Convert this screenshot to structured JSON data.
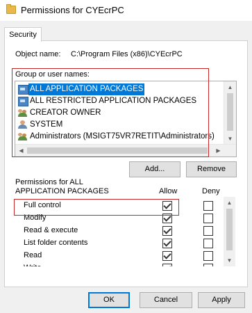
{
  "window": {
    "title": "Permissions for CYEcrPC"
  },
  "tabs": [
    {
      "label": "Security"
    }
  ],
  "object": {
    "label": "Object name:",
    "value": "C:\\Program Files (x86)\\CYEcrPC"
  },
  "groups": {
    "label": "Group or user names:",
    "items": [
      {
        "name": "ALL APPLICATION PACKAGES",
        "icon": "app-package-icon",
        "selected": true
      },
      {
        "name": "ALL RESTRICTED APPLICATION PACKAGES",
        "icon": "app-package-icon",
        "selected": false
      },
      {
        "name": "CREATOR OWNER",
        "icon": "user-group-icon",
        "selected": false
      },
      {
        "name": "SYSTEM",
        "icon": "user-icon",
        "selected": false
      },
      {
        "name": "Administrators (MSIGT75VR7RETIT\\Administrators)",
        "icon": "user-group-icon",
        "selected": false
      }
    ]
  },
  "buttons": {
    "add": "Add...",
    "remove": "Remove",
    "ok": "OK",
    "cancel": "Cancel",
    "apply": "Apply"
  },
  "permissions": {
    "header_line1": "Permissions for ALL",
    "header_line2": "APPLICATION PACKAGES",
    "allow_label": "Allow",
    "deny_label": "Deny",
    "rows": [
      {
        "name": "Full control",
        "allow": true,
        "deny": false
      },
      {
        "name": "Modify",
        "allow": true,
        "deny": false
      },
      {
        "name": "Read & execute",
        "allow": true,
        "deny": false
      },
      {
        "name": "List folder contents",
        "allow": true,
        "deny": false
      },
      {
        "name": "Read",
        "allow": true,
        "deny": false
      },
      {
        "name": "Write",
        "allow": true,
        "deny": false
      }
    ]
  },
  "colors": {
    "selection": "#0078d7",
    "highlight_box": "#c62828",
    "window_bg": "#f0f0f0"
  }
}
